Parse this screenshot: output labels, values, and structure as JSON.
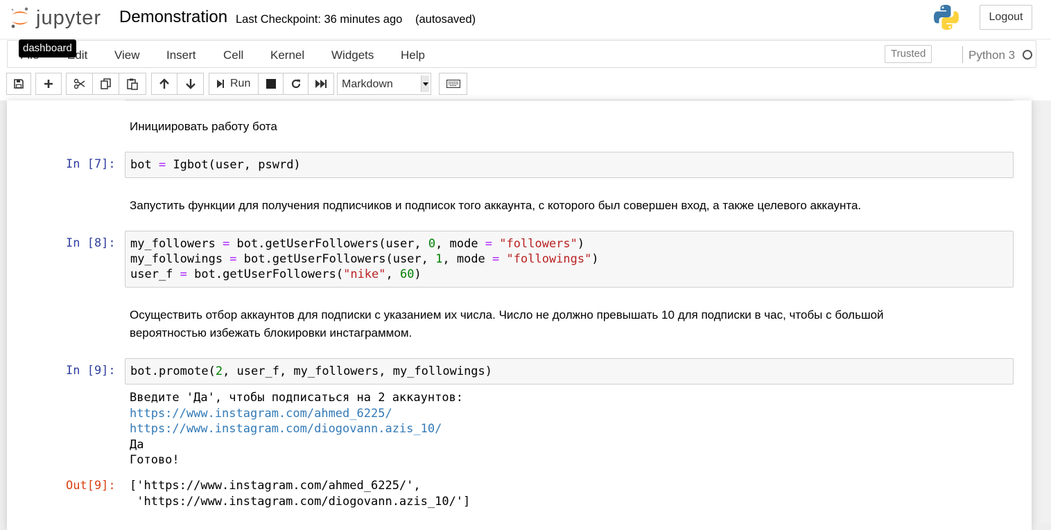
{
  "header": {
    "logo_text": "jupyter",
    "notebook_title": "Demonstration",
    "checkpoint": "Last Checkpoint: 36 minutes ago",
    "autosave": "(autosaved)",
    "logout_label": "Logout"
  },
  "tooltip": "dashboard",
  "menubar": {
    "items": [
      "File",
      "Edit",
      "View",
      "Insert",
      "Cell",
      "Kernel",
      "Widgets",
      "Help"
    ],
    "trusted": "Trusted",
    "kernel_name": "Python 3"
  },
  "toolbar": {
    "run_label": "Run",
    "cell_type": "Markdown"
  },
  "cells": {
    "md1": "Инициировать работу бота",
    "in7_prompt": "In [7]:",
    "in7_code": {
      "a": "bot ",
      "op": "=",
      "b": " Igbot(user, pswrd)"
    },
    "md2": "Запустить функции для получения подписчиков и подписок того аккаунта, с которого был совершен вход, а также целевого аккаунта.",
    "in8_prompt": "In [8]:",
    "in8_code": {
      "l1_a": "my_followers ",
      "l1_op": "=",
      "l1_b": " bot.getUserFollowers(user, ",
      "l1_n": "0",
      "l1_c": ", mode ",
      "l1_op2": "=",
      "l1_sp": " ",
      "l1_s": "\"followers\"",
      "l1_d": ")",
      "l2_a": "my_followings ",
      "l2_op": "=",
      "l2_b": " bot.getUserFollowers(user, ",
      "l2_n": "1",
      "l2_c": ", mode ",
      "l2_op2": "=",
      "l2_sp": " ",
      "l2_s": "\"followings\"",
      "l2_d": ")",
      "l3_a": "user_f ",
      "l3_op": "=",
      "l3_b": " bot.getUserFollowers(",
      "l3_s": "\"nike\"",
      "l3_c": ", ",
      "l3_n": "60",
      "l3_d": ")"
    },
    "md3_line1": "Осуществить отбор аккаунтов для подписки с указанием их числа. Число не должно превышать 10 для подписки в час, чтобы с большой",
    "md3_line2": "вероятностью избежать блокировки инстаграммом.",
    "in9_prompt": "In [9]:",
    "in9_code": {
      "a": "bot.promote(",
      "n": "2",
      "b": ", user_f, my_followers, my_followings)"
    },
    "in9_output": {
      "line1": "Введите 'Да', чтобы подписаться на 2 аккаунтов:",
      "link1": "https://www.instagram.com/ahmed_6225/",
      "link2": "https://www.instagram.com/diogovann.azis_10/",
      "line4": "Да",
      "line5": "Готово!"
    },
    "out9_prompt": "Out[9]:",
    "out9_line1": "['https://www.instagram.com/ahmed_6225/',",
    "out9_line2": " 'https://www.instagram.com/diogovann.azis_10/']"
  },
  "colors": {
    "prompt_in": "#303f9f",
    "prompt_out": "#d84315",
    "link": "#337ab7",
    "keyword_op": "#aa22ff",
    "number": "#008000",
    "string": "#ba2121"
  }
}
